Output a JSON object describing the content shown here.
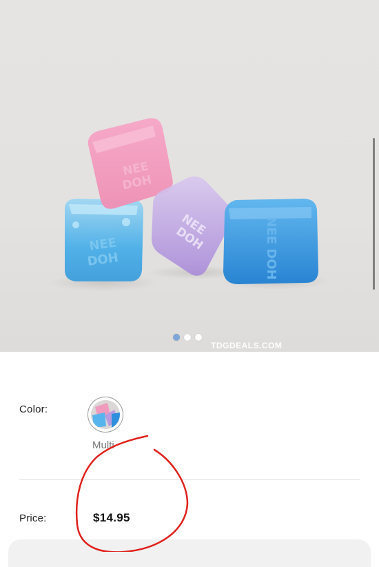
{
  "product": {
    "image_alt": "Product photo of four translucent squishy cubes (pink, blue, purple, blue)",
    "watermark": "TDGDEALS.COM",
    "carousel": {
      "count": 3,
      "active_index": 0
    }
  },
  "options": {
    "color_label": "Color:",
    "selected_color": "Multi"
  },
  "pricing": {
    "price_label": "Price:",
    "price_value": "$14.95"
  },
  "colors": {
    "dot_active": "#7ea6d6",
    "dot_inactive": "#ffffff",
    "annotation_circle": "#e0201b"
  }
}
